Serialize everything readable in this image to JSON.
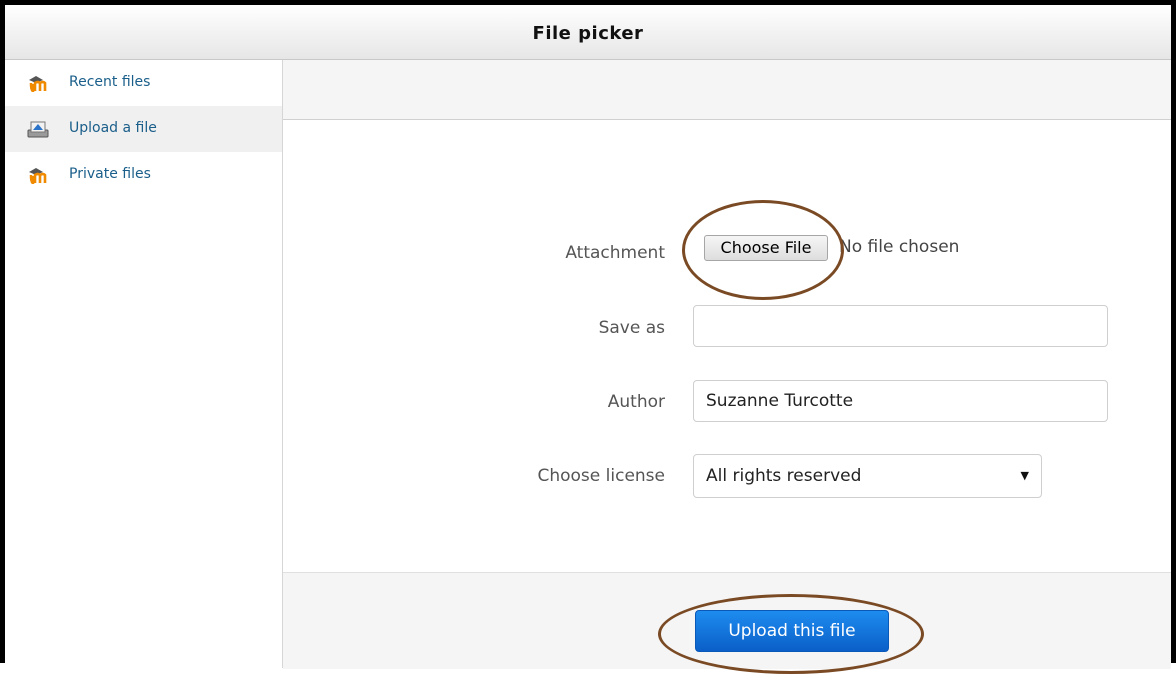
{
  "window": {
    "title": "File picker"
  },
  "sidebar": {
    "items": [
      {
        "label": "Recent files",
        "icon": "moodle-icon"
      },
      {
        "label": "Upload a file",
        "icon": "upload-icon",
        "active": true
      },
      {
        "label": "Private files",
        "icon": "moodle-icon"
      }
    ]
  },
  "form": {
    "attachment_label": "Attachment",
    "choose_file_label": "Choose File",
    "no_file_text": "No file chosen",
    "save_as_label": "Save as",
    "save_as_value": "",
    "author_label": "Author",
    "author_value": "Suzanne Turcotte",
    "license_label": "Choose license",
    "license_value": "All rights reserved"
  },
  "footer": {
    "upload_label": "Upload this file"
  },
  "colors": {
    "annotation": "#7a4a24",
    "primary_button": "#0a6fd6",
    "link": "#1a5e8a"
  }
}
